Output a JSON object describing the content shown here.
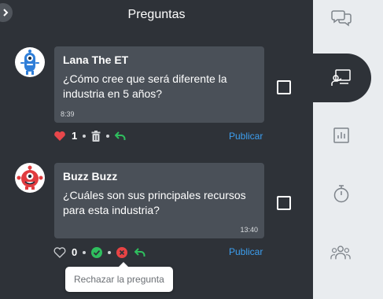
{
  "panel": {
    "title": "Preguntas"
  },
  "questions": [
    {
      "author": "Lana The ET",
      "text": "¿Cómo cree que será diferente la industria en 5 años?",
      "time": "8:39",
      "likes": "1",
      "liked": true,
      "publish_label": "Publicar"
    },
    {
      "author": "Buzz Buzz",
      "text": "¿Cuáles son sus principales recursos para esta industria?",
      "time": "13:40",
      "likes": "0",
      "liked": false,
      "publish_label": "Publicar"
    }
  ],
  "tooltip": {
    "text": "Rechazar la pregunta"
  },
  "icons": {
    "rail": [
      "chat-bubbles-icon",
      "presentation-icon",
      "chart-icon",
      "stopwatch-icon",
      "people-icon"
    ]
  },
  "colors": {
    "panel_bg": "#2e3238",
    "bubble_bg": "#4a5058",
    "rail_bg": "#e9ecef",
    "like_red": "#e8474b",
    "approve_green": "#2fbf5e",
    "reject_red": "#e84344",
    "link_blue": "#3d9ff0"
  }
}
